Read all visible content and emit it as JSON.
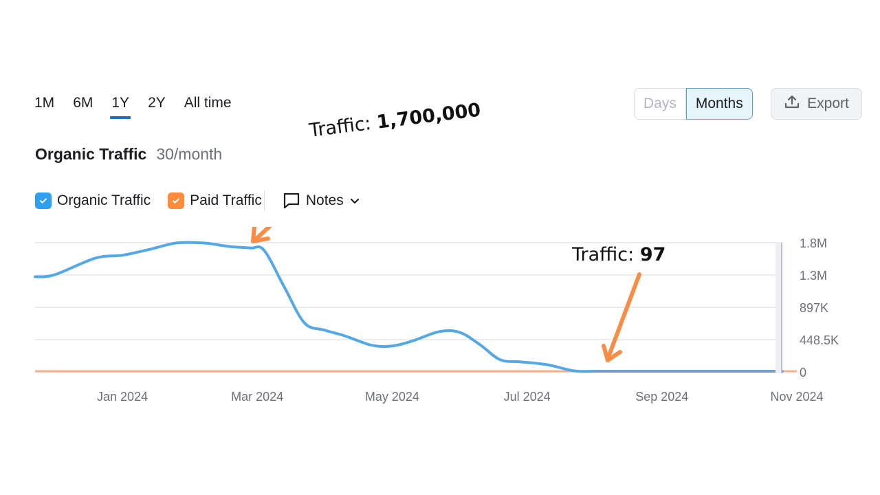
{
  "range_tabs": [
    {
      "label": "1M",
      "active": false
    },
    {
      "label": "6M",
      "active": false
    },
    {
      "label": "1Y",
      "active": true
    },
    {
      "label": "2Y",
      "active": false
    },
    {
      "label": "All time",
      "active": false
    }
  ],
  "granularity": {
    "days_label": "Days",
    "months_label": "Months",
    "selected": "Months"
  },
  "export": {
    "label": "Export",
    "icon": "upload-icon"
  },
  "header": {
    "title": "Organic Traffic",
    "subtitle": "30/month"
  },
  "legend": {
    "items": [
      {
        "label": "Organic Traffic",
        "checked": true,
        "color": "#2da1f0"
      },
      {
        "label": "Paid Traffic",
        "checked": true,
        "color": "#ff8c3a"
      }
    ],
    "notes_label": "Notes"
  },
  "annotations": [
    {
      "prefix": "Traffic: ",
      "value": "1,700,000"
    },
    {
      "prefix": "Traffic: ",
      "value": "97"
    }
  ],
  "colors": {
    "accent": "#1a6fc4",
    "organic": "#55a8e6",
    "paid": "#f7b08a",
    "arrow": "#f88d46"
  },
  "chart_data": {
    "type": "line",
    "title": "Organic Traffic",
    "xlabel": "",
    "ylabel": "",
    "x_ticks": [
      "Jan 2024",
      "Mar 2024",
      "May 2024",
      "Jul 2024",
      "Sep 2024",
      "Nov 2024"
    ],
    "y_ticks": [
      "0",
      "448.5K",
      "897K",
      "1.3M",
      "1.8M"
    ],
    "y_tick_values": [
      0,
      448500,
      897000,
      1345500,
      1794000
    ],
    "ylim": [
      0,
      1794000
    ],
    "xlim_months": [
      -1.3,
      10
    ],
    "grid": true,
    "legend_position": "top-left",
    "series": [
      {
        "name": "Organic Traffic",
        "x_months": [
          -1.3,
          -1.0,
          -0.4,
          0.0,
          0.4,
          0.8,
          1.2,
          1.6,
          1.9,
          2.1,
          2.4,
          2.7,
          3.0,
          3.3,
          3.7,
          4.0,
          4.3,
          4.7,
          5.0,
          5.3,
          5.6,
          5.9,
          6.3,
          6.7,
          7.0,
          7.3,
          8.0,
          9.0,
          10.0
        ],
        "values": [
          1320000,
          1350000,
          1580000,
          1620000,
          1700000,
          1790000,
          1790000,
          1740000,
          1720000,
          1690000,
          1180000,
          680000,
          580000,
          500000,
          370000,
          360000,
          430000,
          560000,
          550000,
          380000,
          170000,
          140000,
          100000,
          15000,
          97,
          97,
          97,
          97,
          97
        ]
      },
      {
        "name": "Paid Traffic",
        "x_months": [
          -1.3,
          10.0
        ],
        "values": [
          0,
          0
        ]
      }
    ],
    "annotations": [
      {
        "text": "Traffic: 1,700,000",
        "x_month": 1.9,
        "value": 1700000
      },
      {
        "text": "Traffic: 97",
        "x_month": 7.6,
        "value": 97
      }
    ]
  }
}
